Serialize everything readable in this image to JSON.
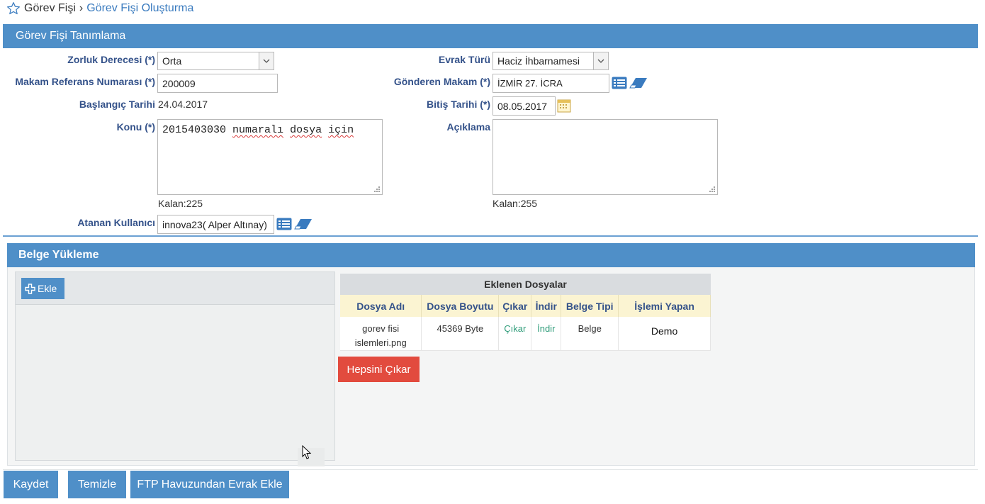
{
  "breadcrumb": {
    "home": "Görev Fişi",
    "separator": "›",
    "current": "Görev Fişi Oluşturma"
  },
  "panel_definition": {
    "title": "Görev Fişi Tanımlama",
    "zorluk": {
      "label": "Zorluk Derecesi (*)",
      "value": "Orta"
    },
    "evrak": {
      "label": "Evrak Türü",
      "value": "Haciz İhbarnamesi"
    },
    "makam_ref": {
      "label": "Makam Referans Numarası (*)",
      "value": "200009"
    },
    "gonderen": {
      "label": "Gönderen Makam (*)",
      "value": "İZMİR 27. İCRA"
    },
    "baslangic": {
      "label": "Başlangıç Tarihi",
      "value": "24.04.2017"
    },
    "bitis": {
      "label": "Bitiş Tarihi (*)",
      "value": "08.05.2017"
    },
    "konu": {
      "label": "Konu (*)",
      "value_number": "2015403030",
      "value_word1": "numaralı",
      "value_word2": "dosya",
      "value_word3": "için",
      "remaining": "Kalan:225"
    },
    "aciklama": {
      "label": "Açıklama",
      "value": "",
      "remaining": "Kalan:255"
    },
    "atanan": {
      "label": "Atanan Kullanıcı",
      "value": "innova23( Alper Altınay)"
    }
  },
  "panel_upload": {
    "title": "Belge Yükleme",
    "add_label": "Ekle",
    "files_title": "Eklenen Dosyalar",
    "columns": [
      "Dosya Adı",
      "Dosya Boyutu",
      "Çıkar",
      "İndir",
      "Belge Tipi",
      "İşlemi Yapan"
    ],
    "rows": [
      {
        "name_line1": "gorev fisi",
        "name_line2": "islemleri.png",
        "size": "45369 Byte",
        "remove": "Çıkar",
        "download": "İndir",
        "type": "Belge",
        "by": "Demo"
      }
    ],
    "remove_all_label": "Hepsini Çıkar"
  },
  "footer": {
    "save_label": "Kaydet",
    "clear_label": "Temizle",
    "ftp_label": "FTP Havuzundan Evrak Ekle"
  },
  "colors": {
    "panel_header": "#4f8fc8",
    "label": "#34528a",
    "danger": "#e24b3e",
    "link": "#2f9c7a",
    "table_header": "#fbf4d2"
  },
  "icons": [
    "star-icon",
    "list-icon",
    "eraser-icon",
    "calendar-icon",
    "plus-icon",
    "chevron-down-icon",
    "resize-grip-icon",
    "mouse-cursor-icon"
  ]
}
